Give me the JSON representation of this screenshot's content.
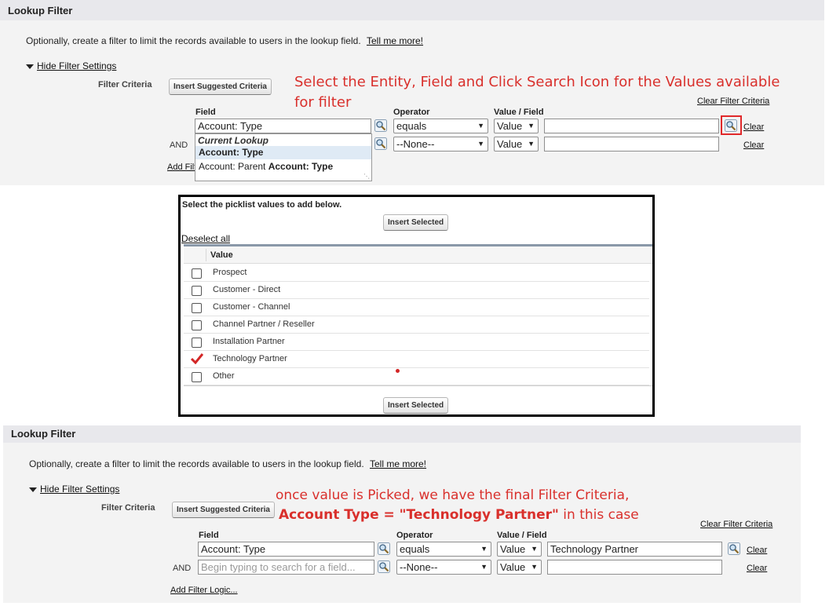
{
  "top": {
    "title": "Lookup Filter",
    "description": "Optionally, create a filter to limit the records available to users in the lookup field.",
    "tell_me_more": "Tell me more!",
    "hide_filter_settings": "Hide Filter Settings",
    "filter_criteria_label": "Filter Criteria",
    "insert_suggested_criteria": "Insert Suggested Criteria",
    "clear_filter_criteria": "Clear Filter Criteria",
    "col_field": "Field",
    "col_operator": "Operator",
    "col_value_field": "Value / Field",
    "row1": {
      "field": "Account: Type",
      "operator": "equals",
      "value_type": "Value",
      "value": "",
      "clear": "Clear"
    },
    "row2": {
      "and": "AND",
      "field": "",
      "operator": "--None--",
      "value_type": "Value",
      "value": "",
      "clear": "Clear"
    },
    "add_filter_logic_partial": "Add Filt",
    "dropdown": {
      "header": "Current Lookup",
      "item1": "Account: Type",
      "item2_prefix": "Account: Parent ",
      "item2_bold": "Account: Type"
    }
  },
  "annotation_top": {
    "line1": "Select the Entity, Field and Click Search Icon for the Values available",
    "line2": "for filter"
  },
  "picklist": {
    "instruction": "Select the picklist values to add below.",
    "insert_selected": "Insert Selected",
    "deselect_all": "Deselect all",
    "column_header": "Value",
    "items": [
      {
        "label": "Prospect",
        "checked": false
      },
      {
        "label": "Customer - Direct",
        "checked": false
      },
      {
        "label": "Customer - Channel",
        "checked": false
      },
      {
        "label": "Channel Partner / Reseller",
        "checked": false
      },
      {
        "label": "Installation Partner",
        "checked": false
      },
      {
        "label": "Technology Partner",
        "checked": true
      },
      {
        "label": "Other",
        "checked": false
      }
    ],
    "insert_selected_bottom": "Insert Selected"
  },
  "bottom": {
    "title": "Lookup Filter",
    "description": "Optionally, create a filter to limit the records available to users in the lookup field.",
    "tell_me_more": "Tell me more!",
    "hide_filter_settings": "Hide Filter Settings",
    "filter_criteria_label": "Filter Criteria",
    "insert_suggested_criteria": "Insert Suggested Criteria",
    "clear_filter_criteria": "Clear Filter Criteria",
    "col_field": "Field",
    "col_operator": "Operator",
    "col_value_field": "Value / Field",
    "row1": {
      "field": "Account: Type",
      "operator": "equals",
      "value_type": "Value",
      "value": "Technology Partner",
      "clear": "Clear"
    },
    "row2": {
      "and": "AND",
      "field_placeholder": "Begin typing to search for a field...",
      "operator": "--None--",
      "value_type": "Value",
      "value": "",
      "clear": "Clear"
    },
    "add_filter_logic": "Add Filter Logic..."
  },
  "annotation_bottom": {
    "line1": "once value is Picked, we have the final Filter Criteria,",
    "line2": "Account Type = \"Technology Partner\"",
    "line2_suffix": " in this case"
  },
  "colors": {
    "annotation": "#d9302c",
    "highlight_box": "#e0282a",
    "check": "#d32626",
    "panel": "#f3f3f3",
    "header": "#e8e8ec"
  }
}
